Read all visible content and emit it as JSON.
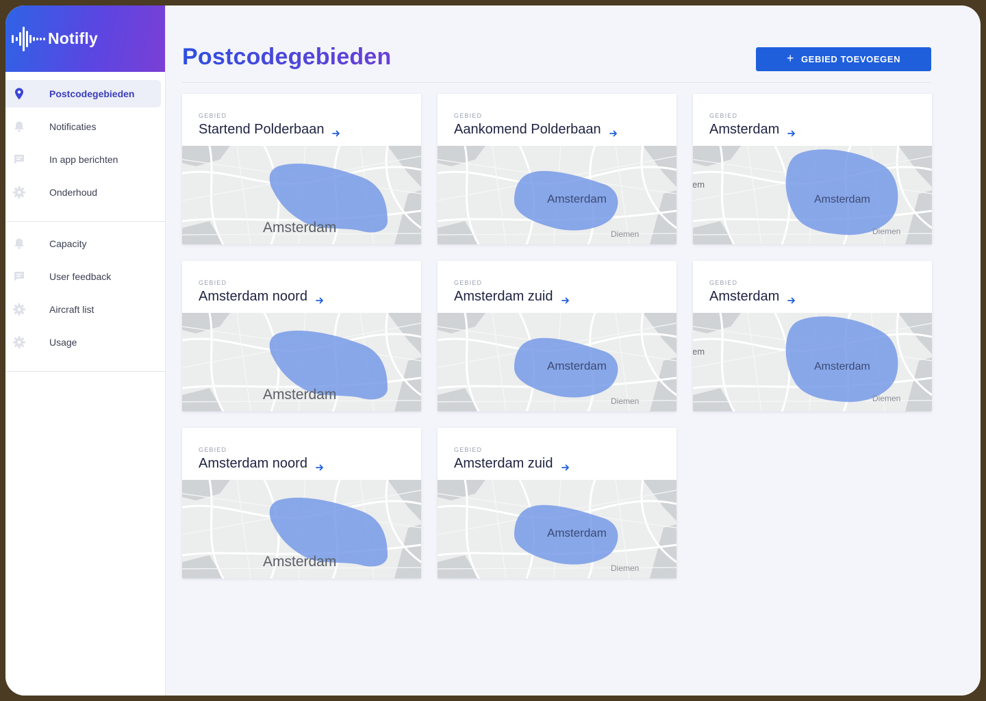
{
  "app": {
    "name": "Notifly"
  },
  "sidebar": {
    "groups": [
      [
        {
          "label": "Postcodegebieden",
          "icon": "map-pin-icon",
          "active": true
        },
        {
          "label": "Notificaties",
          "icon": "bell-icon",
          "active": false
        },
        {
          "label": "In app berichten",
          "icon": "message-icon",
          "active": false
        },
        {
          "label": "Onderhoud",
          "icon": "gear-icon",
          "active": false
        }
      ],
      [
        {
          "label": "Capacity",
          "icon": "bell-icon",
          "active": false
        },
        {
          "label": "User feedback",
          "icon": "message-icon",
          "active": false
        },
        {
          "label": "Aircraft list",
          "icon": "gear-icon",
          "active": false
        },
        {
          "label": "Usage",
          "icon": "gear-icon",
          "active": false
        }
      ]
    ]
  },
  "header": {
    "title": "Postcodegebieden",
    "add_button": {
      "label": "GEBIED TOEVOEGEN",
      "icon": "plus-icon"
    }
  },
  "colors": {
    "accent": "#1f5fdc",
    "area_fill": "#6f95e6",
    "active_nav": "#3b3fb8"
  },
  "cards": [
    {
      "kicker": "GEBIED",
      "title": "Startend Polderbaan",
      "map_label": "Amsterdam",
      "variant": "north",
      "extra_labels": []
    },
    {
      "kicker": "GEBIED",
      "title": "Aankomend Polderbaan",
      "map_label": "Amsterdam",
      "variant": "south",
      "extra_labels": [
        "Diemen"
      ]
    },
    {
      "kicker": "GEBIED",
      "title": "Amsterdam",
      "map_label": "Amsterdam",
      "variant": "city",
      "extra_labels": [
        "Diemen",
        "em"
      ]
    },
    {
      "kicker": "GEBIED",
      "title": "Amsterdam noord",
      "map_label": "Amsterdam",
      "variant": "north",
      "extra_labels": []
    },
    {
      "kicker": "GEBIED",
      "title": "Amsterdam zuid",
      "map_label": "Amsterdam",
      "variant": "south",
      "extra_labels": [
        "Diemen"
      ]
    },
    {
      "kicker": "GEBIED",
      "title": "Amsterdam",
      "map_label": "Amsterdam",
      "variant": "city",
      "extra_labels": [
        "Diemen",
        "em"
      ]
    },
    {
      "kicker": "GEBIED",
      "title": "Amsterdam noord",
      "map_label": "Amsterdam",
      "variant": "north",
      "extra_labels": []
    },
    {
      "kicker": "GEBIED",
      "title": "Amsterdam zuid",
      "map_label": "Amsterdam",
      "variant": "south",
      "extra_labels": [
        "Diemen"
      ]
    }
  ]
}
